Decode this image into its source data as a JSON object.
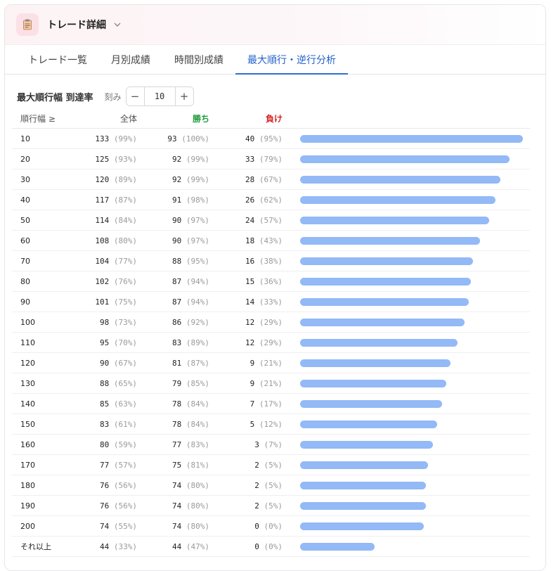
{
  "header": {
    "title": "トレード詳細",
    "icon": "clipboard-icon",
    "chevron_icon": "chevron-down-icon"
  },
  "tabs": [
    {
      "label": "トレード一覧",
      "active": false
    },
    {
      "label": "月別成績",
      "active": false
    },
    {
      "label": "時間別成績",
      "active": false
    },
    {
      "label": "最大順行・逆行分析",
      "active": true
    }
  ],
  "section": {
    "title": "最大順行幅 到達率",
    "step_label": "刻み",
    "step_value": "10",
    "minus": "−",
    "plus": "+"
  },
  "table": {
    "columns": {
      "threshold": "順行幅 ≥",
      "all": "全体",
      "win": "勝ち",
      "loss": "負け"
    },
    "bar_color": "#93b9f6",
    "rows": [
      {
        "threshold": "10",
        "all": "133",
        "all_pct": "(99%)",
        "win": "93",
        "win_pct": "(100%)",
        "loss": "40",
        "loss_pct": "(95%)",
        "ratio": 0.99
      },
      {
        "threshold": "20",
        "all": "125",
        "all_pct": "(93%)",
        "win": "92",
        "win_pct": "(99%)",
        "loss": "33",
        "loss_pct": "(79%)",
        "ratio": 0.93
      },
      {
        "threshold": "30",
        "all": "120",
        "all_pct": "(89%)",
        "win": "92",
        "win_pct": "(99%)",
        "loss": "28",
        "loss_pct": "(67%)",
        "ratio": 0.89
      },
      {
        "threshold": "40",
        "all": "117",
        "all_pct": "(87%)",
        "win": "91",
        "win_pct": "(98%)",
        "loss": "26",
        "loss_pct": "(62%)",
        "ratio": 0.87
      },
      {
        "threshold": "50",
        "all": "114",
        "all_pct": "(84%)",
        "win": "90",
        "win_pct": "(97%)",
        "loss": "24",
        "loss_pct": "(57%)",
        "ratio": 0.84
      },
      {
        "threshold": "60",
        "all": "108",
        "all_pct": "(80%)",
        "win": "90",
        "win_pct": "(97%)",
        "loss": "18",
        "loss_pct": "(43%)",
        "ratio": 0.8
      },
      {
        "threshold": "70",
        "all": "104",
        "all_pct": "(77%)",
        "win": "88",
        "win_pct": "(95%)",
        "loss": "16",
        "loss_pct": "(38%)",
        "ratio": 0.77
      },
      {
        "threshold": "80",
        "all": "102",
        "all_pct": "(76%)",
        "win": "87",
        "win_pct": "(94%)",
        "loss": "15",
        "loss_pct": "(36%)",
        "ratio": 0.76
      },
      {
        "threshold": "90",
        "all": "101",
        "all_pct": "(75%)",
        "win": "87",
        "win_pct": "(94%)",
        "loss": "14",
        "loss_pct": "(33%)",
        "ratio": 0.75
      },
      {
        "threshold": "100",
        "all": "98",
        "all_pct": "(73%)",
        "win": "86",
        "win_pct": "(92%)",
        "loss": "12",
        "loss_pct": "(29%)",
        "ratio": 0.73
      },
      {
        "threshold": "110",
        "all": "95",
        "all_pct": "(70%)",
        "win": "83",
        "win_pct": "(89%)",
        "loss": "12",
        "loss_pct": "(29%)",
        "ratio": 0.7
      },
      {
        "threshold": "120",
        "all": "90",
        "all_pct": "(67%)",
        "win": "81",
        "win_pct": "(87%)",
        "loss": "9",
        "loss_pct": "(21%)",
        "ratio": 0.67
      },
      {
        "threshold": "130",
        "all": "88",
        "all_pct": "(65%)",
        "win": "79",
        "win_pct": "(85%)",
        "loss": "9",
        "loss_pct": "(21%)",
        "ratio": 0.65
      },
      {
        "threshold": "140",
        "all": "85",
        "all_pct": "(63%)",
        "win": "78",
        "win_pct": "(84%)",
        "loss": "7",
        "loss_pct": "(17%)",
        "ratio": 0.63
      },
      {
        "threshold": "150",
        "all": "83",
        "all_pct": "(61%)",
        "win": "78",
        "win_pct": "(84%)",
        "loss": "5",
        "loss_pct": "(12%)",
        "ratio": 0.61
      },
      {
        "threshold": "160",
        "all": "80",
        "all_pct": "(59%)",
        "win": "77",
        "win_pct": "(83%)",
        "loss": "3",
        "loss_pct": "(7%)",
        "ratio": 0.59
      },
      {
        "threshold": "170",
        "all": "77",
        "all_pct": "(57%)",
        "win": "75",
        "win_pct": "(81%)",
        "loss": "2",
        "loss_pct": "(5%)",
        "ratio": 0.57
      },
      {
        "threshold": "180",
        "all": "76",
        "all_pct": "(56%)",
        "win": "74",
        "win_pct": "(80%)",
        "loss": "2",
        "loss_pct": "(5%)",
        "ratio": 0.56
      },
      {
        "threshold": "190",
        "all": "76",
        "all_pct": "(56%)",
        "win": "74",
        "win_pct": "(80%)",
        "loss": "2",
        "loss_pct": "(5%)",
        "ratio": 0.56
      },
      {
        "threshold": "200",
        "all": "74",
        "all_pct": "(55%)",
        "win": "74",
        "win_pct": "(80%)",
        "loss": "0",
        "loss_pct": "(0%)",
        "ratio": 0.55
      },
      {
        "threshold": "それ以上",
        "all": "44",
        "all_pct": "(33%)",
        "win": "44",
        "win_pct": "(47%)",
        "loss": "0",
        "loss_pct": "(0%)",
        "ratio": 0.33
      }
    ]
  }
}
